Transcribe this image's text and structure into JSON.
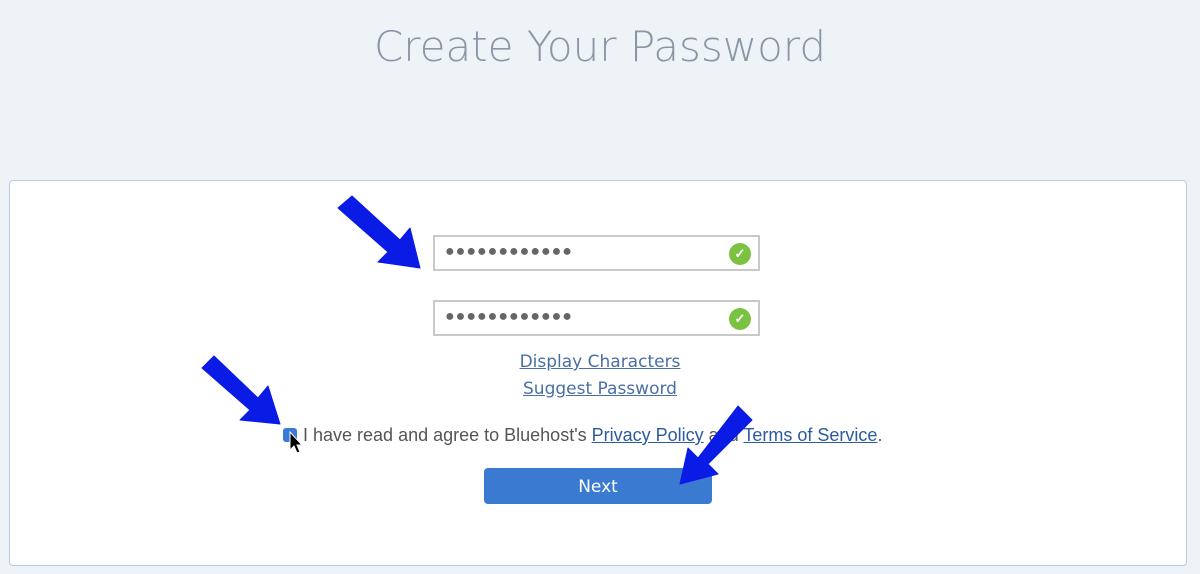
{
  "title": "Create Your Password",
  "password": {
    "value": "●●●●●●●●●●●●",
    "status_icon": "check-circle-icon"
  },
  "confirm": {
    "value": "●●●●●●●●●●●●",
    "status_icon": "check-circle-icon"
  },
  "links": {
    "display": "Display Characters",
    "suggest": "Suggest Password"
  },
  "agree": {
    "checked": true,
    "text_before": "I have read and agree to Bluehost's ",
    "privacy": "Privacy Policy",
    "middle": " and ",
    "terms": "Terms of Service",
    "end": "."
  },
  "next_label": "Next",
  "colors": {
    "accent": "#3a7ad0",
    "success": "#7cc242",
    "arrow": "#0a1be6"
  }
}
